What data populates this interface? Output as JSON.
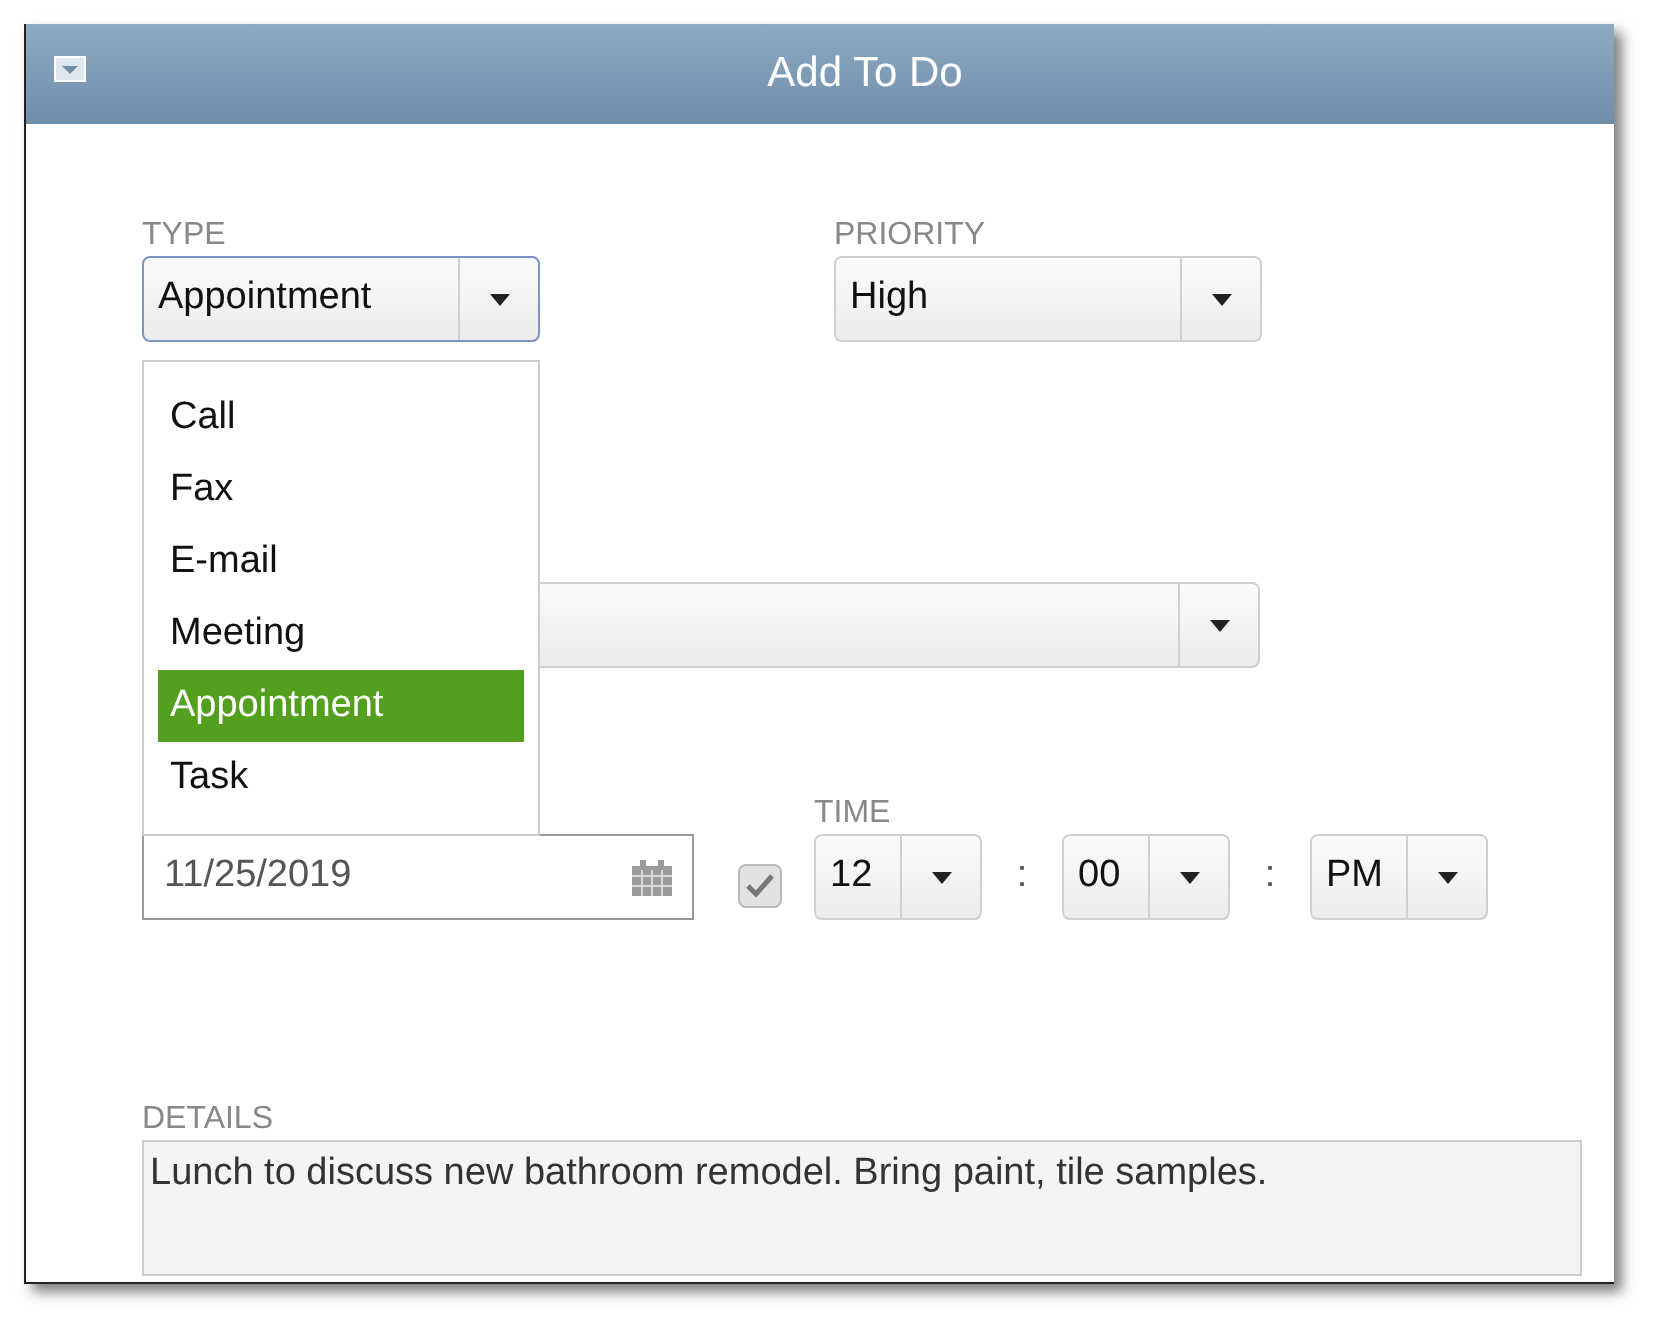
{
  "window": {
    "title": "Add To Do"
  },
  "type": {
    "label": "TYPE",
    "value": "Appointment",
    "expanded": true,
    "options": [
      {
        "label": "Call",
        "selected": false
      },
      {
        "label": "Fax",
        "selected": false
      },
      {
        "label": "E-mail",
        "selected": false
      },
      {
        "label": "Meeting",
        "selected": false
      },
      {
        "label": "Appointment",
        "selected": true
      },
      {
        "label": "Task",
        "selected": false
      }
    ]
  },
  "priority": {
    "label": "PRIORITY",
    "value": "High"
  },
  "date": {
    "value": "11/25/2019"
  },
  "time": {
    "label": "TIME",
    "checked": true,
    "hour": "12",
    "separator_1": ":",
    "minute": "00",
    "separator_2": ":",
    "period": "PM"
  },
  "details": {
    "label": "DETAILS",
    "value": "Lunch to discuss new bathroom remodel. Bring paint, tile samples."
  }
}
